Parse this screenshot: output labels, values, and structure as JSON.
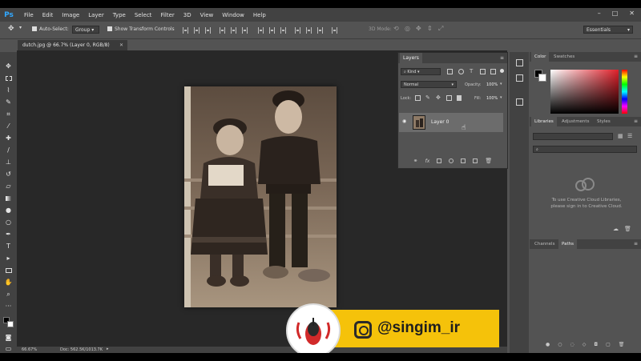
{
  "app": {
    "logo": "Ps"
  },
  "menu": [
    "File",
    "Edit",
    "Image",
    "Layer",
    "Type",
    "Select",
    "Filter",
    "3D",
    "View",
    "Window",
    "Help"
  ],
  "window_controls": [
    "–",
    "□",
    "✕"
  ],
  "options": {
    "auto_select_label": "Auto-Select:",
    "auto_select_value": "Group",
    "show_transform_label": "Show Transform Controls",
    "mode_3d_label": "3D Mode:",
    "workspace": "Essentials"
  },
  "document": {
    "tab_title": "dutch.jpg @ 66.7% (Layer 0, RGB/8)",
    "zoom": "66.67%",
    "doc_info": "Doc: 562.5K/1013.7K"
  },
  "layers_panel": {
    "tab": "Layers",
    "filter_kind": "Kind",
    "blend_mode": "Normal",
    "opacity_label": "Opacity:",
    "opacity_value": "100%",
    "lock_label": "Lock:",
    "fill_label": "Fill:",
    "fill_value": "100%",
    "layers": [
      {
        "name": "Layer 0",
        "visible": true
      }
    ]
  },
  "color_panel": {
    "tabs": [
      "Color",
      "Swatches"
    ]
  },
  "libraries_panel": {
    "tabs": [
      "Libraries",
      "Adjustments",
      "Styles"
    ],
    "message_line1": "To use Creative Cloud Libraries,",
    "message_line2": "please sign in to Creative Cloud."
  },
  "bottom_panel": {
    "tabs": [
      "Channels",
      "Paths"
    ]
  },
  "watermark": {
    "handle": "@singim_ir"
  },
  "colors": {
    "ps_blue": "#31a8ff",
    "watermark_yellow": "#f5c20a",
    "canvas": "#282828"
  }
}
